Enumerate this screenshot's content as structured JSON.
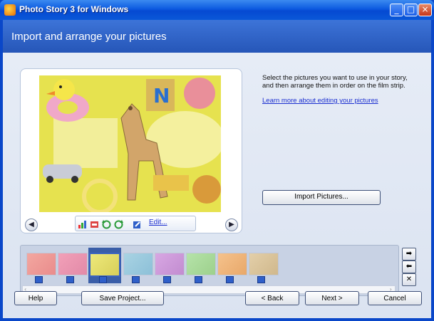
{
  "window": {
    "title": "Photo Story 3 for Windows",
    "minimize_glyph": "_",
    "maximize_glyph": "□",
    "close_glyph": "×"
  },
  "banner": {
    "title": "Import and arrange your pictures"
  },
  "instructions": {
    "text": "Select the pictures you want to use in your story, and then arrange them in order on the film strip.",
    "learn_link": "Learn more about editing your pictures"
  },
  "preview": {
    "edit_label": "Edit...",
    "prev_glyph": "◀",
    "next_glyph": "▶",
    "photo_letter": "N"
  },
  "import_button": "Import Pictures...",
  "filmstrip": {
    "thumbnail_count": 8,
    "selected_index": 2,
    "move_right_glyph": "➡",
    "move_left_glyph": "⬅",
    "remove_glyph": "✕",
    "scroll_left_glyph": "‹",
    "scroll_right_glyph": "›"
  },
  "buttons": {
    "help": "Help",
    "save": "Save Project...",
    "back": "< Back",
    "next": "Next >",
    "cancel": "Cancel"
  },
  "colors": {
    "titlebar": "#0c5ae0",
    "banner": "#2f63c6",
    "content_bg": "#dfe6f3",
    "link": "#1b2fd0"
  }
}
